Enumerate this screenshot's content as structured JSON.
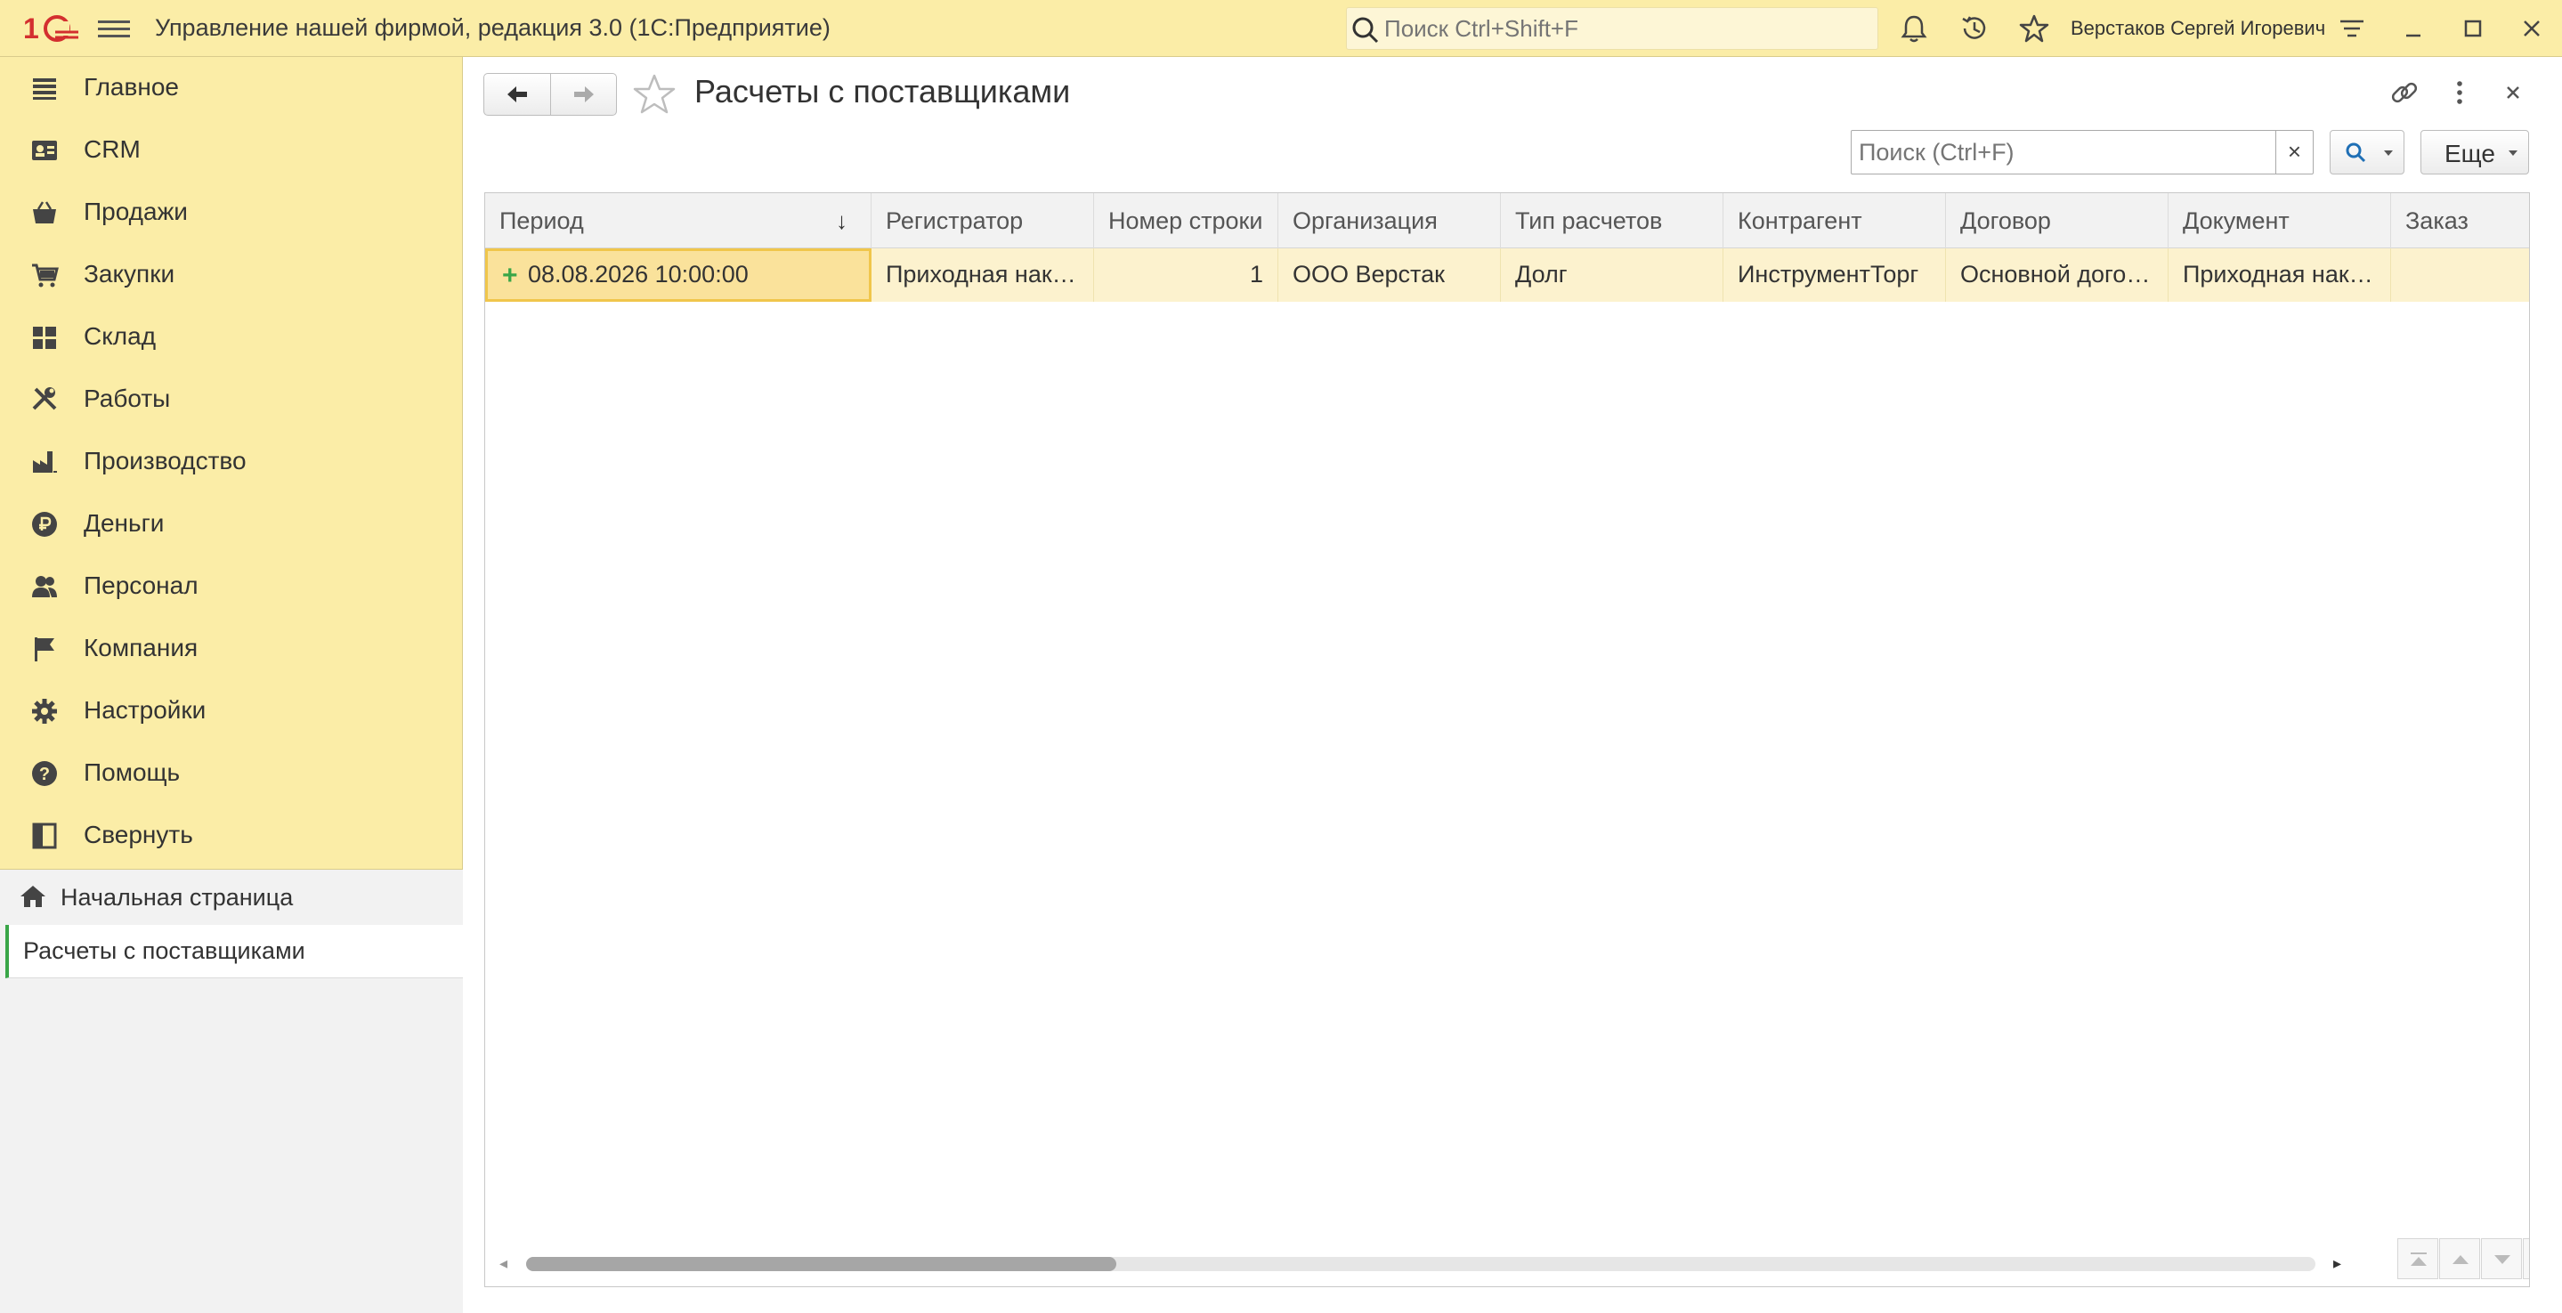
{
  "app": {
    "title": "Управление нашей фирмой, редакция 3.0  (1С:Предприятие)",
    "search_placeholder": "Поиск Ctrl+Shift+F",
    "user": "Верстаков Сергей Игоревич",
    "brand_color": "#d32f2f"
  },
  "sidebar": {
    "items": [
      {
        "label": "Главное",
        "icon": "list-icon"
      },
      {
        "label": "CRM",
        "icon": "contact-card-icon"
      },
      {
        "label": "Продажи",
        "icon": "basket-icon"
      },
      {
        "label": "Закупки",
        "icon": "cart-icon"
      },
      {
        "label": "Склад",
        "icon": "warehouse-grid-icon"
      },
      {
        "label": "Работы",
        "icon": "tools-icon"
      },
      {
        "label": "Производство",
        "icon": "factory-icon"
      },
      {
        "label": "Деньги",
        "icon": "ruble-icon"
      },
      {
        "label": "Персонал",
        "icon": "people-icon"
      },
      {
        "label": "Компания",
        "icon": "flag-icon"
      },
      {
        "label": "Настройки",
        "icon": "gear-icon"
      },
      {
        "label": "Помощь",
        "icon": "help-icon"
      },
      {
        "label": "Свернуть",
        "icon": "collapse-panel-icon"
      }
    ],
    "home": "Начальная страница",
    "open_windows": [
      "Расчеты с поставщиками"
    ]
  },
  "form": {
    "title": "Расчеты с поставщиками",
    "search_placeholder": "Поиск (Ctrl+F)",
    "clear_label": "×",
    "more_label": "Еще"
  },
  "table": {
    "columns": [
      "Период",
      "Регистратор",
      "Номер строки",
      "Организация",
      "Тип расчетов",
      "Контрагент",
      "Договор",
      "Документ",
      "Заказ"
    ],
    "sort_indicator": "↓",
    "rows": [
      {
        "period": "08.08.2026 10:00:00",
        "registrator": "Приходная нак…",
        "line_no": "1",
        "organization": "ООО Верстак",
        "settlement_type": "Долг",
        "counterparty": "ИнструментТорг",
        "contract": "Основной дого…",
        "document": "Приходная нак…",
        "order": ""
      }
    ],
    "row_marker": "+",
    "scroll_fraction": 0.33
  }
}
